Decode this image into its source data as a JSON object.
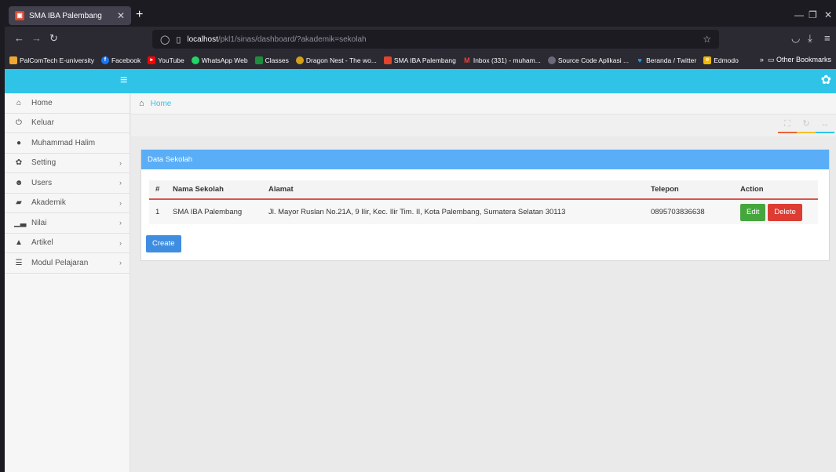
{
  "browser": {
    "tab_title": "SMA IBA Palembang",
    "url_host": "localhost",
    "url_path": "/pkl1/sinas/dashboard/?akademik=sekolah",
    "bookmarks": [
      {
        "label": "PalComTech E-university",
        "icon": "palcomtech-icon",
        "color": "#f0a830"
      },
      {
        "label": "Facebook",
        "icon": "facebook-icon",
        "color": "#1877f2"
      },
      {
        "label": "YouTube",
        "icon": "youtube-icon",
        "color": "#ff0000"
      },
      {
        "label": "WhatsApp Web",
        "icon": "whatsapp-icon",
        "color": "#25d366"
      },
      {
        "label": "Classes",
        "icon": "classes-icon",
        "color": "#1e8e3e"
      },
      {
        "label": "Dragon Nest - The wo...",
        "icon": "dragon-nest-icon",
        "color": "#d4a017"
      },
      {
        "label": "SMA IBA Palembang",
        "icon": "sma-iba-icon",
        "color": "#e0442d"
      },
      {
        "label": "Inbox (331) - muham...",
        "icon": "gmail-icon",
        "color": "#ea4335"
      },
      {
        "label": "Source Code Aplikasi ...",
        "icon": "source-code-icon",
        "color": "#6a6a7a"
      },
      {
        "label": "Beranda / Twitter",
        "icon": "twitter-icon",
        "color": "#1da1f2"
      },
      {
        "label": "Edmodo",
        "icon": "edmodo-icon",
        "color": "#f5b800"
      }
    ],
    "other_bookmarks": "Other Bookmarks"
  },
  "sidebar": {
    "items": [
      {
        "label": "Home",
        "icon": "home-icon",
        "chevron": false
      },
      {
        "label": "Keluar",
        "icon": "power-icon",
        "chevron": false
      },
      {
        "label": "Muhammad Halim",
        "icon": "user-icon",
        "chevron": false
      },
      {
        "label": "Setting",
        "icon": "gear-icon",
        "chevron": true
      },
      {
        "label": "Users",
        "icon": "users-icon",
        "chevron": true
      },
      {
        "label": "Akademik",
        "icon": "book-icon",
        "chevron": true
      },
      {
        "label": "Nilai",
        "icon": "signal-icon",
        "chevron": true
      },
      {
        "label": "Artikel",
        "icon": "thumbs-up-icon",
        "chevron": true
      },
      {
        "label": "Modul Pelajaran",
        "icon": "list-icon",
        "chevron": true
      }
    ]
  },
  "breadcrumb": {
    "label": "Home"
  },
  "panel": {
    "title": "Data Sekolah",
    "columns": [
      "#",
      "Nama Sekolah",
      "Alamat",
      "Telepon",
      "Action"
    ],
    "rows": [
      {
        "no": "1",
        "nama": "SMA IBA Palembang",
        "alamat": "Jl. Mayor Ruslan No.21A, 9 Ilir, Kec. Ilir Tim. II, Kota Palembang, Sumatera Selatan 30113",
        "telepon": "0895703836638"
      }
    ],
    "edit_label": "Edit",
    "delete_label": "Delete",
    "create_label": "Create"
  },
  "colors": {
    "topbar": "#2fc3e8",
    "panel_header": "#5aaef7",
    "edit": "#45a63d",
    "delete": "#dd3c33",
    "create": "#3f8de0"
  }
}
